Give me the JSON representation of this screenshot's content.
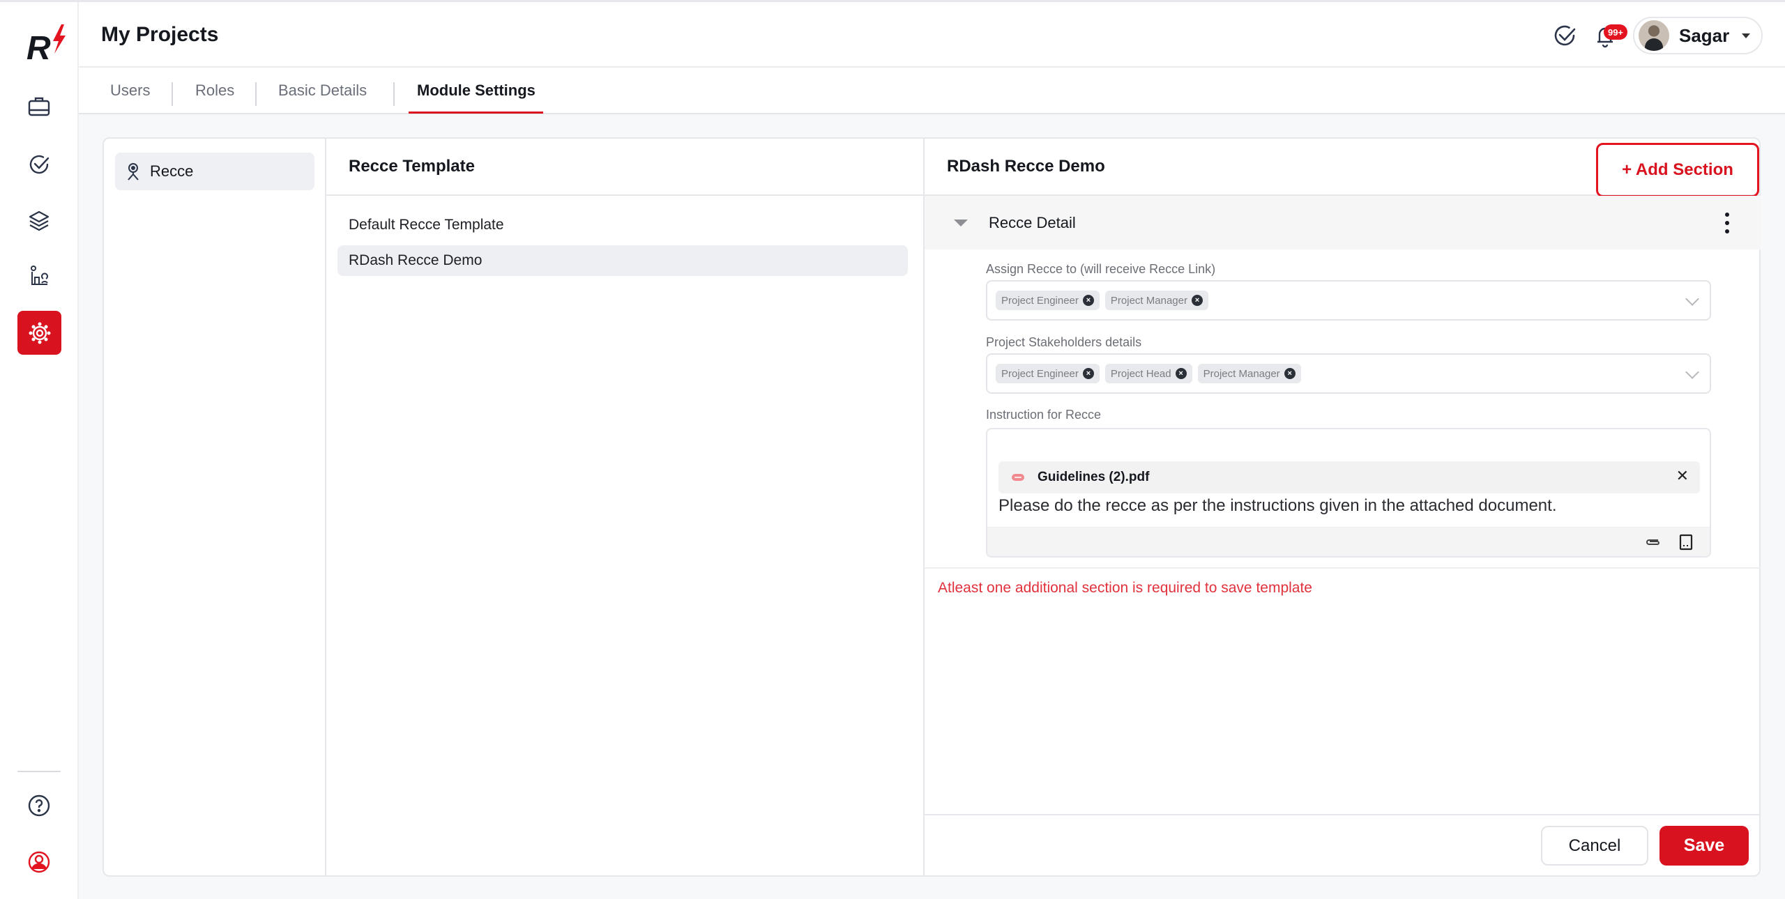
{
  "app": {
    "logo_text": "R"
  },
  "header": {
    "title": "My Projects",
    "notification_badge": "99+",
    "user_name": "Sagar"
  },
  "rail": {
    "items": [
      {
        "icon": "briefcase-icon",
        "label": "Projects"
      },
      {
        "icon": "task-check-icon",
        "label": "Tasks"
      },
      {
        "icon": "layers-icon",
        "label": "Layers"
      },
      {
        "icon": "site-icon",
        "label": "Site"
      },
      {
        "icon": "settings-icon",
        "label": "Settings",
        "active": true
      }
    ],
    "bottom": [
      {
        "icon": "help-icon"
      },
      {
        "icon": "user-profile-icon"
      }
    ]
  },
  "tabs": [
    {
      "label": "Users"
    },
    {
      "label": "Roles"
    },
    {
      "label": "Basic Details"
    },
    {
      "label": "Module Settings",
      "active": true
    }
  ],
  "modules": [
    {
      "label": "Recce",
      "icon": "surveyor-icon",
      "selected": true
    }
  ],
  "templates": {
    "heading": "Recce Template",
    "items": [
      {
        "label": "Default Recce Template"
      },
      {
        "label": "RDash Recce Demo",
        "selected": true
      }
    ]
  },
  "editor_panel": {
    "title": "RDash Recce Demo",
    "add_section_label": "+ Add Section",
    "section": {
      "title": "Recce Detail",
      "fields": [
        {
          "label": "Assign Recce to (will receive Recce Link)",
          "chips": [
            "Project Engineer",
            "Project Manager"
          ]
        },
        {
          "label": "Project Stakeholders details",
          "chips": [
            "Project Engineer",
            "Project Head",
            "Project Manager"
          ]
        }
      ],
      "instruction": {
        "label": "Instruction for Recce",
        "attachment_name": "Guidelines (2).pdf",
        "text": "Please do the recce as per the instructions given in the attached document."
      }
    },
    "error_message": "Atleast one additional section is required to save template",
    "cancel_label": "Cancel",
    "save_label": "Save"
  },
  "colors": {
    "brand_red": "#d9121f",
    "error_red": "#e0313c",
    "text_dark": "#15181e"
  }
}
